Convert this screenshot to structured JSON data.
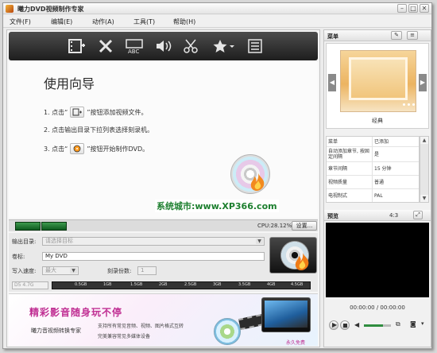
{
  "window": {
    "title": "曦力DVD视频制作专家",
    "controls": {
      "minimize": "–",
      "maximize": "□",
      "close": "✕"
    }
  },
  "menubar": {
    "items": [
      "文件(F)",
      "编辑(E)",
      "动作(A)",
      "工具(T)",
      "帮助(H)"
    ]
  },
  "toolbar": {
    "buttons": [
      "add-video-icon",
      "delete-icon",
      "abc-subtitle-icon",
      "audio-icon",
      "edit-clip-icon",
      "effect-icon",
      "list-icon"
    ]
  },
  "guide": {
    "title": "使用向导",
    "step1_prefix": "1. 点击“",
    "step1_suffix": "”按钮添加视频文件。",
    "step2": "2. 点击输出目录下拉列表选择刻录机。",
    "step3_prefix": "3. 点击“",
    "step3_suffix": "”按钮开始制作DVD。"
  },
  "watermark": "系统城市:www.XP366.com",
  "capacity": {
    "cpu": "CPU:28.12%",
    "settings_label": "设置..."
  },
  "form": {
    "output_label": "输出目录:",
    "output_placeholder": "请选择目标",
    "volume_label": "卷标:",
    "volume_value": "My DVD",
    "write_speed_label": "写入速度:",
    "write_speed_value": "最大",
    "copies_label": "刻录份数:",
    "copies_value": "1",
    "disc_size_value": "D5 4.7G",
    "ruler_ticks": [
      "0.5GB",
      "1GB",
      "1.5GB",
      "2GB",
      "2.5GB",
      "3GB",
      "3.5GB",
      "4GB",
      "4.5GB"
    ]
  },
  "banner": {
    "slogan": "精彩影音随身玩不停",
    "product": "曦力音视频转换专家",
    "line1": "支持所有常见音频、视频、图片格式互转",
    "line2": "完美兼容常见多媒体设备",
    "free": "永久免费"
  },
  "menu_panel": {
    "title": "菜单",
    "template_name": "经典"
  },
  "properties": [
    {
      "key": "菜单",
      "value": "已添加"
    },
    {
      "key": "自动添加章节, 按固定间隔",
      "value": "是"
    },
    {
      "key": "章节间隔",
      "value": "15 分钟"
    },
    {
      "key": "视频质量",
      "value": "普通"
    },
    {
      "key": "电视制式",
      "value": "PAL"
    }
  ],
  "preview": {
    "title": "预览",
    "aspect_ratio": "4:3",
    "time": "00:00:00 / 00:00:00"
  },
  "colors": {
    "toolbar_bg": "#2a2a2a",
    "capacity_green": "#1f7a31",
    "watermark_green": "#1c7f2e",
    "banner_pink": "#c02f93",
    "video_bg": "#000000"
  }
}
